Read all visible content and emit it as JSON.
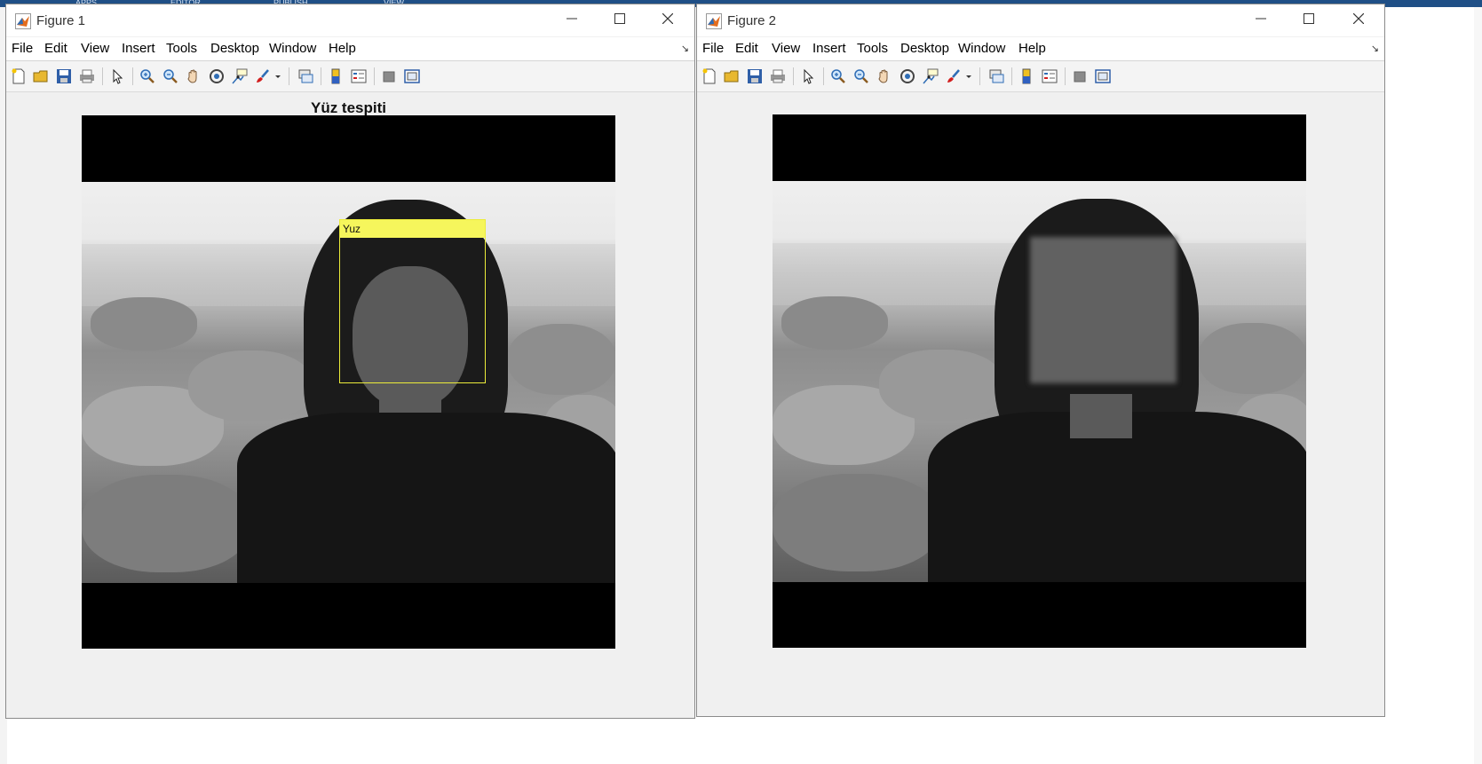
{
  "background": {
    "tabs": [
      "APPS",
      "EDITOR",
      "PUBLISH",
      "VIEW"
    ]
  },
  "menu_items": [
    "File",
    "Edit",
    "View",
    "Insert",
    "Tools",
    "Desktop",
    "Window",
    "Help"
  ],
  "toolbar_icons": [
    "new-figure-icon",
    "open-file-icon",
    "save-icon",
    "print-icon",
    "edit-plot-arrow-icon",
    "zoom-in-icon",
    "zoom-out-icon",
    "pan-hand-icon",
    "rotate-3d-icon",
    "data-cursor-icon",
    "brush-icon",
    "brush-dropdown-icon",
    "link-plot-icon",
    "insert-colorbar-icon",
    "insert-legend-icon",
    "hide-plot-tools-icon",
    "show-plot-tools-icon"
  ],
  "windows": [
    {
      "title": "Figure 1",
      "plot_title": "Yüz tespiti",
      "bbox_label": "Yuz"
    },
    {
      "title": "Figure 2",
      "plot_title": "",
      "bbox_label": ""
    }
  ],
  "colors": {
    "bbox_yellow": "#ecec3a",
    "toolbar_bg": "#f4f4f4",
    "window_bg": "#f0f0f0"
  }
}
